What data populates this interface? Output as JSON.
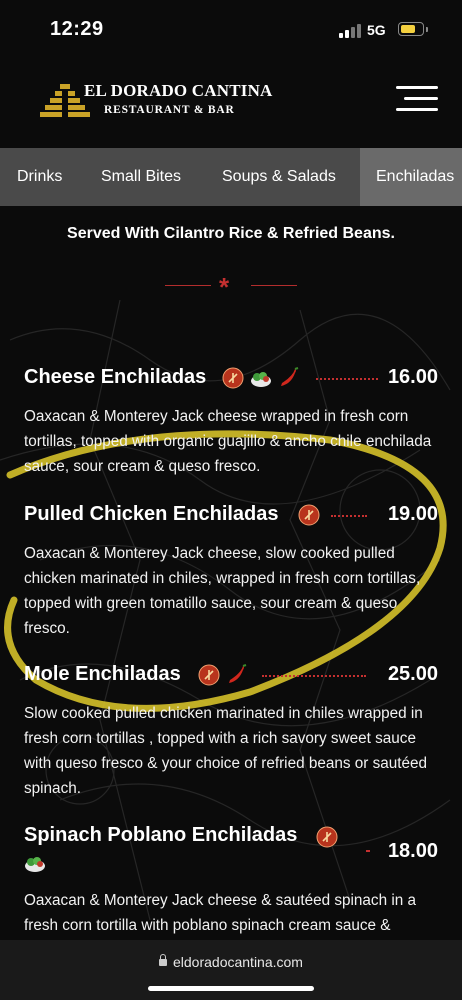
{
  "status_bar": {
    "time": "12:29",
    "network": "5G"
  },
  "header": {
    "logo_title": "EL DORADO CANTINA",
    "logo_subtitle": "RESTAURANT & BAR",
    "menu_icon": "hamburger-menu-icon"
  },
  "tabs": [
    {
      "label": "Drinks",
      "active": false
    },
    {
      "label": "Small Bites",
      "active": false
    },
    {
      "label": "Soups & Salads",
      "active": false
    },
    {
      "label": "Enchiladas",
      "active": true
    }
  ],
  "section": {
    "note": "Served With Cilantro Rice & Refried Beans."
  },
  "items": [
    {
      "name": "Cheese Enchiladas",
      "price": "16.00",
      "icons": [
        "gluten-free-icon",
        "vegetarian-icon",
        "spicy-chile-icon"
      ],
      "description": "Oaxacan & Monterey Jack cheese wrapped in fresh corn tortillas, topped with organic guajillo & ancho chile enchilada sauce, sour cream & queso fresco."
    },
    {
      "name": "Pulled Chicken Enchiladas",
      "price": "19.00",
      "icons": [
        "gluten-free-icon"
      ],
      "description": "Oaxacan & Monterey Jack cheese, slow cooked pulled chicken marinated in chiles, wrapped in fresh corn tortillas, topped with green tomatillo sauce, sour cream & queso fresco."
    },
    {
      "name": "Mole Enchiladas",
      "price": "25.00",
      "icons": [
        "gluten-free-icon",
        "spicy-chile-icon"
      ],
      "description": "Slow cooked pulled chicken marinated in chiles wrapped in fresh corn tortillas , topped with a rich savory sweet sauce with queso fresco & your choice of refried beans or sautéed spinach."
    },
    {
      "name": "Spinach Poblano Enchiladas",
      "price": "18.00",
      "icons": [
        "gluten-free-icon",
        "vegetarian-icon"
      ],
      "description": "Oaxacan & Monterey Jack cheese & sautéed spinach in a fresh corn tortilla with poblano spinach cream sauce &"
    }
  ],
  "browser": {
    "url": "eldoradocantina.com"
  },
  "colors": {
    "background": "#0b0b0b",
    "tab_bar": "#4a4a4a",
    "tab_active": "#6a6a6a",
    "accent_red": "#c43030",
    "gold": "#c9a227",
    "highlight_circle": "#d9c52a"
  }
}
